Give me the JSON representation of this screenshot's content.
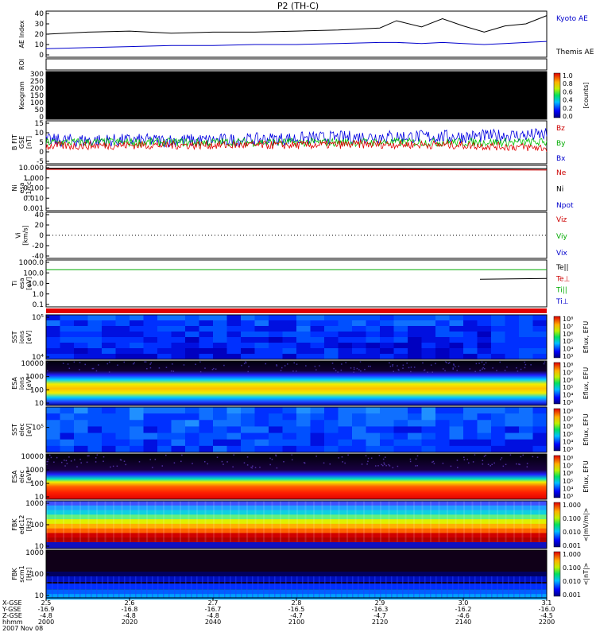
{
  "title": "P2 (TH-C)",
  "panels": [
    {
      "id": "ae",
      "ylabel": [
        "AE Index"
      ],
      "ticks": [
        "40",
        "30",
        "20",
        "10",
        "0"
      ],
      "legend": [
        {
          "text": "Kyoto AE",
          "color": "#0000cc"
        },
        {
          "text": "Themis AE",
          "color": "#000000"
        }
      ]
    },
    {
      "id": "roi",
      "ylabel": [
        "ROI"
      ],
      "ticks": [],
      "legend": []
    },
    {
      "id": "keo",
      "ylabel": [
        "Keogram"
      ],
      "ticks": [
        "300",
        "250",
        "200",
        "150",
        "100",
        "50",
        "0"
      ],
      "legend": [],
      "colorbar": {
        "ticks": [
          "1.0",
          "0.8",
          "0.6",
          "0.4",
          "0.2",
          "0.0"
        ],
        "label": "[counts]"
      }
    },
    {
      "id": "bfield",
      "ylabel": [
        "B FIT",
        "GSE",
        "[nT]"
      ],
      "ticks": [
        "15",
        "10",
        "5",
        "0",
        "-5"
      ],
      "legend": [
        {
          "text": "Bz",
          "color": "#cc0000"
        },
        {
          "text": "By",
          "color": "#00aa00"
        },
        {
          "text": "Bx",
          "color": "#0000cc"
        }
      ]
    },
    {
      "id": "density",
      "ylabel": [
        "Ni",
        "esa",
        "[1/cc]"
      ],
      "ticks": [
        "10.000",
        "1.000",
        "0.100",
        "0.010",
        "0.001"
      ],
      "legend": [
        {
          "text": "Ne",
          "color": "#cc0000"
        },
        {
          "text": "Ni",
          "color": "#000000"
        },
        {
          "text": "Npot",
          "color": "#0000cc"
        }
      ]
    },
    {
      "id": "velocity",
      "ylabel": [
        "Vi",
        "[km/s]"
      ],
      "ticks": [
        "40",
        "20",
        "0",
        "-20",
        "-40"
      ],
      "legend": [
        {
          "text": "Viz",
          "color": "#cc0000"
        },
        {
          "text": "Viy",
          "color": "#00aa00"
        },
        {
          "text": "Vix",
          "color": "#0000cc"
        }
      ]
    },
    {
      "id": "temp",
      "ylabel": [
        "Ti",
        "esa",
        "[eV]"
      ],
      "ticks": [
        "1000.0",
        "100.0",
        "10.0",
        "1.0",
        "0.1"
      ],
      "legend": [
        {
          "text": "Te||",
          "color": "#000000"
        },
        {
          "text": "Te⊥",
          "color": "#cc0000"
        },
        {
          "text": "Ti||",
          "color": "#00aa00"
        },
        {
          "text": "Ti⊥",
          "color": "#0000cc"
        }
      ]
    },
    {
      "id": "sst_i",
      "ylabel": [
        "SST",
        "ions",
        "[eV]"
      ],
      "ticks": [
        "10⁵",
        "10⁴"
      ],
      "legend": [],
      "colorbar": {
        "ticks": [
          "10⁸",
          "10⁷",
          "10⁶",
          "10⁵",
          "10⁴",
          "10³"
        ],
        "label": "Eflux, EFU"
      }
    },
    {
      "id": "esa_i",
      "ylabel": [
        "ESA",
        "ions",
        "[eV]"
      ],
      "ticks": [
        "10000",
        "1000",
        "100",
        "10"
      ],
      "legend": [],
      "colorbar": {
        "ticks": [
          "10⁸",
          "10⁷",
          "10⁶",
          "10⁵",
          "10⁴",
          "10³"
        ],
        "label": "Eflux, EFU"
      }
    },
    {
      "id": "sst_e",
      "ylabel": [
        "SST",
        "elec",
        "[eV]"
      ],
      "ticks": [
        "10⁵"
      ],
      "legend": [],
      "colorbar": {
        "ticks": [
          "10⁸",
          "10⁷",
          "10⁶",
          "10⁵",
          "10⁴",
          "10³"
        ],
        "label": "Eflux, EFU"
      }
    },
    {
      "id": "esa_e",
      "ylabel": [
        "ESA",
        "elec",
        "[eV]"
      ],
      "ticks": [
        "10000",
        "1000",
        "100",
        "10"
      ],
      "legend": [],
      "colorbar": {
        "ticks": [
          "10⁸",
          "10⁷",
          "10⁶",
          "10⁵",
          "10⁴",
          "10³"
        ],
        "label": "Eflux, EFU"
      }
    },
    {
      "id": "fbk_e",
      "ylabel": [
        "FBK",
        "edc12",
        "[Hz]"
      ],
      "ticks": [
        "1000",
        "100",
        "10"
      ],
      "legend": [],
      "colorbar": {
        "ticks": [
          "1.000",
          "0.100",
          "0.010",
          "0.001"
        ],
        "label": "<|mV/m|>"
      }
    },
    {
      "id": "fbk_b",
      "ylabel": [
        "FBK",
        "scm1",
        "[Hz]"
      ],
      "ticks": [
        "1000",
        "100",
        "10"
      ],
      "legend": [],
      "colorbar": {
        "ticks": [
          "1.000",
          "0.100",
          "0.010",
          "0.001"
        ],
        "label": "<|nT|>"
      }
    }
  ],
  "xaxis": {
    "row_labels": [
      "X-GSE",
      "Y-GSE",
      "Z-GSE",
      "hhmm",
      "2007 Nov 08"
    ],
    "columns": [
      {
        "vals": [
          "2.5",
          "-16.9",
          "-4.8",
          "2000"
        ]
      },
      {
        "vals": [
          "2.6",
          "-16.8",
          "-4.8",
          "2020"
        ]
      },
      {
        "vals": [
          "2.7",
          "-16.7",
          "-4.8",
          "2040"
        ]
      },
      {
        "vals": [
          "2.8",
          "-16.5",
          "-4.7",
          "2100"
        ]
      },
      {
        "vals": [
          "2.9",
          "-16.3",
          "-4.7",
          "2120"
        ]
      },
      {
        "vals": [
          "3.0",
          "-16.2",
          "-4.6",
          "2140"
        ]
      },
      {
        "vals": [
          "3.1",
          "-16.0",
          "-4.5",
          "2200"
        ]
      }
    ]
  },
  "chart_data": [
    {
      "type": "line",
      "title": "P2 (TH-C)",
      "ylabel": "AE Index",
      "ylim": [
        0,
        40
      ],
      "x": [
        "2000",
        "2010",
        "2020",
        "2030",
        "2040",
        "2050",
        "2100",
        "2110",
        "2120",
        "2124",
        "2130",
        "2135",
        "2140",
        "2145",
        "2150",
        "2155",
        "2200"
      ],
      "series": [
        {
          "name": "Themis AE",
          "values": [
            20,
            22,
            23,
            21,
            22,
            22,
            23,
            24,
            26,
            33,
            27,
            35,
            28,
            22,
            28,
            30,
            38
          ]
        },
        {
          "name": "Kyoto AE",
          "values": [
            6,
            7,
            8,
            9,
            9,
            10,
            10,
            11,
            12,
            12,
            11,
            12,
            11,
            10,
            11,
            12,
            13
          ]
        }
      ]
    },
    {
      "type": "heatmap",
      "ylabel": "Keogram",
      "ylim": [
        0,
        300
      ],
      "value": 0.0
    },
    {
      "type": "line",
      "ylabel": "B FIT GSE [nT]",
      "ylim": [
        -5,
        15
      ],
      "x": [
        "2000",
        "2020",
        "2040",
        "2100",
        "2120",
        "2140",
        "2200"
      ],
      "series": [
        {
          "name": "Bz",
          "values": [
            3,
            3.5,
            3.5,
            3.5,
            4,
            3.5,
            2
          ]
        },
        {
          "name": "By",
          "values": [
            5,
            5,
            5,
            5,
            5,
            5,
            5
          ]
        },
        {
          "name": "Bx",
          "values": [
            6,
            6,
            6,
            7,
            8,
            8,
            9
          ]
        }
      ]
    },
    {
      "type": "line",
      "ylabel": "Ni esa [1/cc]",
      "ylim": [
        0.001,
        10
      ],
      "yscale": "log",
      "x": [
        "2000",
        "2100",
        "2200"
      ],
      "series": [
        {
          "name": "Ne",
          "values": [
            7,
            7,
            6
          ]
        },
        {
          "name": "Ni",
          "values": [
            9,
            9,
            8
          ]
        }
      ]
    },
    {
      "type": "line",
      "ylabel": "Vi [km/s]",
      "ylim": [
        -50,
        50
      ],
      "x": [
        "2000",
        "2200"
      ],
      "series": []
    },
    {
      "type": "line",
      "ylabel": "Ti esa [eV]",
      "ylim": [
        0.1,
        1000
      ],
      "yscale": "log",
      "x": [
        "2000",
        "2100",
        "2144",
        "2200"
      ],
      "series": [
        {
          "name": "Ti||",
          "values": [
            200,
            200,
            200,
            200
          ]
        },
        {
          "name": "Te||",
          "values": [
            null,
            null,
            25,
            30
          ]
        }
      ]
    },
    {
      "type": "heatmap",
      "ylabel": "SST ions [eV]"
    },
    {
      "type": "heatmap",
      "ylabel": "ESA ions [eV]"
    },
    {
      "type": "heatmap",
      "ylabel": "SST elec [eV]"
    },
    {
      "type": "heatmap",
      "ylabel": "ESA elec [eV]"
    },
    {
      "type": "heatmap",
      "ylabel": "FBK edc12 [Hz]"
    },
    {
      "type": "heatmap",
      "ylabel": "FBK scm1 [Hz]"
    }
  ]
}
